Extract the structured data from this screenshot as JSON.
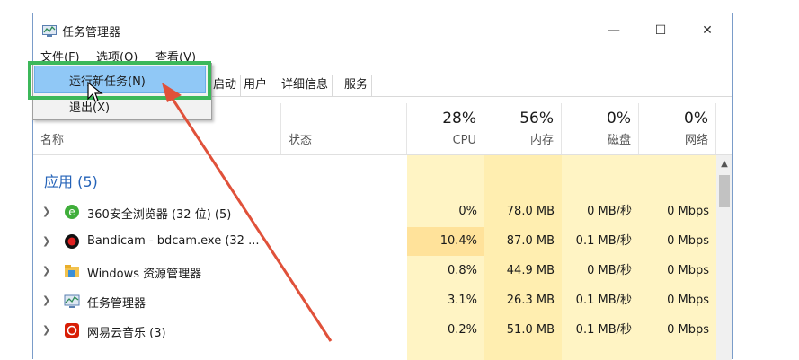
{
  "window": {
    "title": "任务管理器",
    "minimize": "—",
    "maximize": "☐",
    "close": "✕"
  },
  "menu": {
    "file": "文件(F)",
    "options": "选项(O)",
    "view": "查看(V)"
  },
  "dropdown": {
    "run_new_task": "运行新任务(N)",
    "exit": "退出(X)"
  },
  "tabs": {
    "partial": "启动",
    "users": "用户",
    "details": "详细信息",
    "services": "服务"
  },
  "columns": {
    "name": "名称",
    "status": "状态",
    "cpu_pct": "28%",
    "cpu": "CPU",
    "mem_pct": "56%",
    "mem": "内存",
    "disk_pct": "0%",
    "disk": "磁盘",
    "net_pct": "0%",
    "net": "网络"
  },
  "group_label": "应用 (5)",
  "rows": [
    {
      "name": "360安全浏览器 (32 位) (5)",
      "cpu": "0%",
      "mem": "78.0 MB",
      "disk": "0 MB/秒",
      "net": "0 Mbps",
      "icon": "360-browser-icon"
    },
    {
      "name": "Bandicam - bdcam.exe (32 ...",
      "cpu": "10.4%",
      "mem": "87.0 MB",
      "disk": "0.1 MB/秒",
      "net": "0 Mbps",
      "icon": "bandicam-icon"
    },
    {
      "name": "Windows 资源管理器",
      "cpu": "0.8%",
      "mem": "44.9 MB",
      "disk": "0 MB/秒",
      "net": "0 Mbps",
      "icon": "explorer-icon"
    },
    {
      "name": "任务管理器",
      "cpu": "3.1%",
      "mem": "26.3 MB",
      "disk": "0.1 MB/秒",
      "net": "0 Mbps",
      "icon": "task-manager-icon"
    },
    {
      "name": "网易云音乐 (3)",
      "cpu": "0.2%",
      "mem": "51.0 MB",
      "disk": "0.1 MB/秒",
      "net": "0 Mbps",
      "icon": "netease-music-icon"
    }
  ],
  "colors": {
    "accent_blue": "#2563b8",
    "highlight": "#90c8f6",
    "annotation_green": "#3cb85a",
    "arrow_red": "#e0513a"
  }
}
